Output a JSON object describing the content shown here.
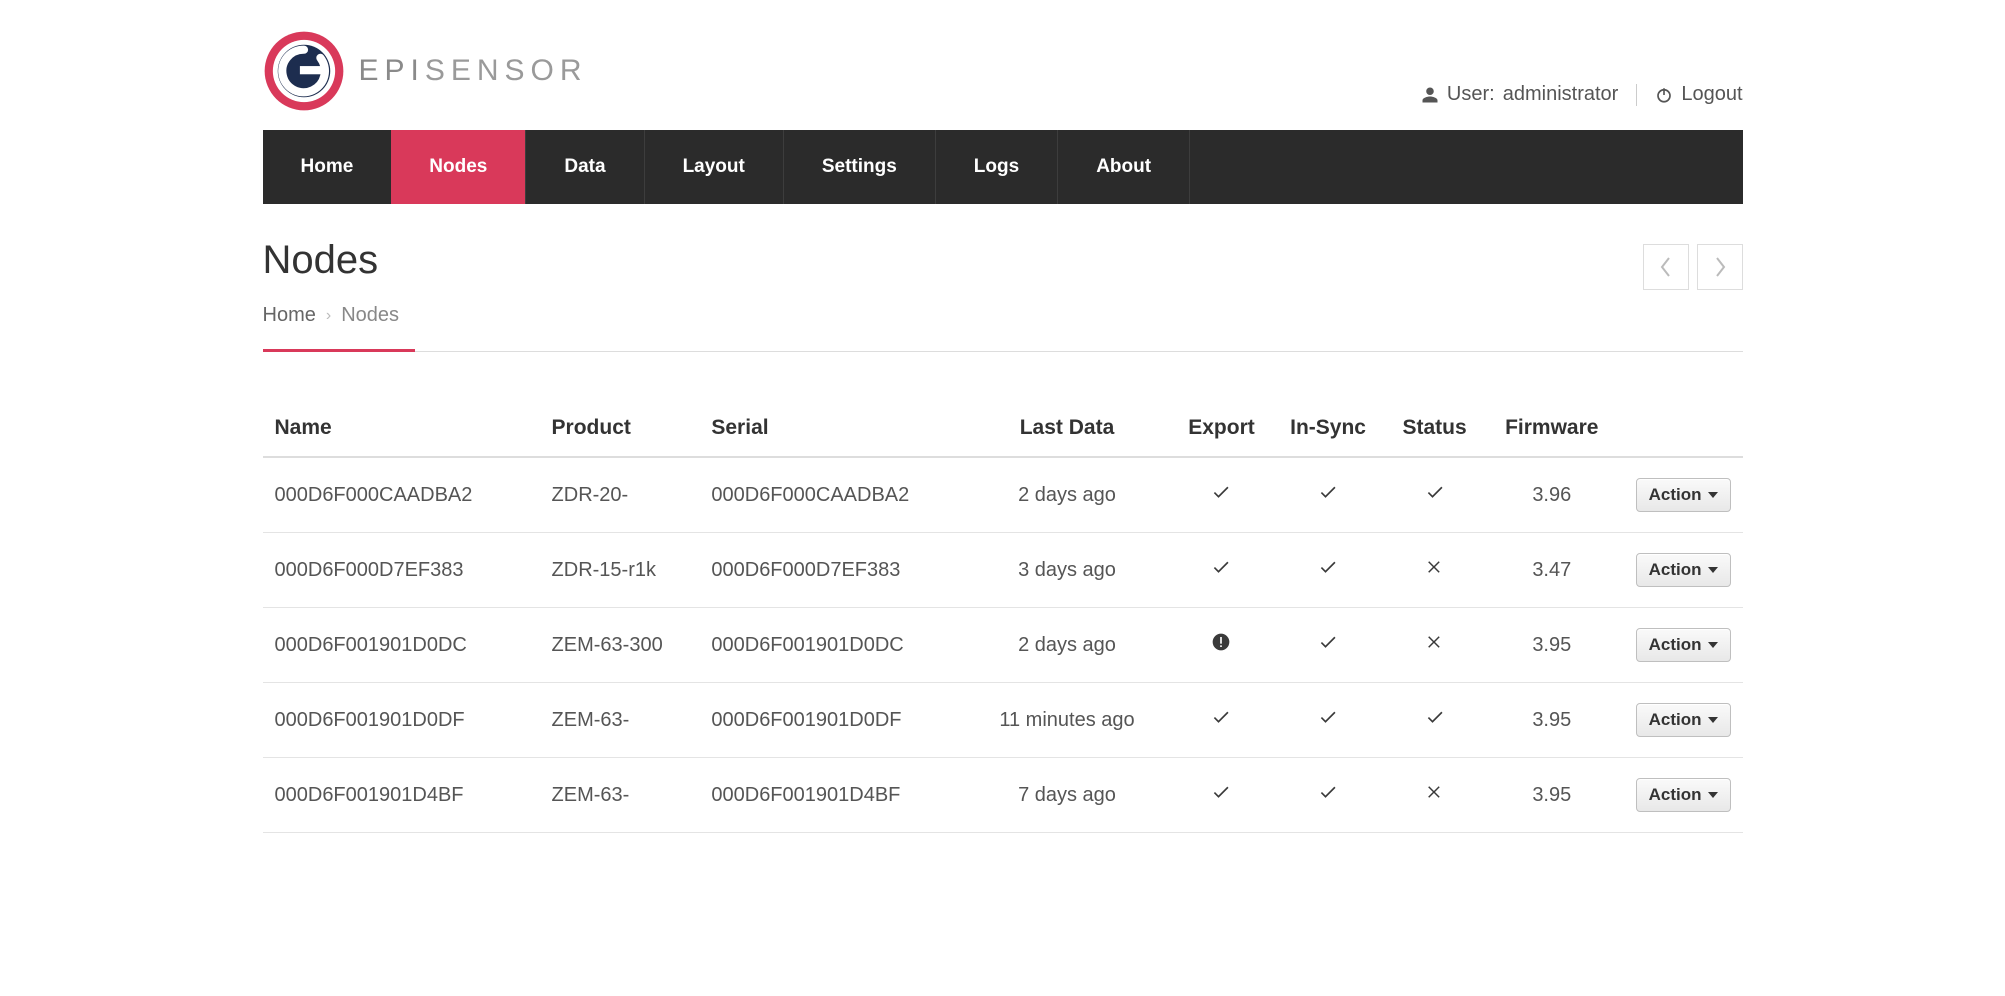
{
  "brand": {
    "name_prefix": "EPI",
    "name_suffix": "SENSOR"
  },
  "user_bar": {
    "user_label": "User:",
    "user_name": "administrator",
    "logout": "Logout"
  },
  "nav": {
    "items": [
      {
        "label": "Home"
      },
      {
        "label": "Nodes",
        "active": true
      },
      {
        "label": "Data"
      },
      {
        "label": "Layout"
      },
      {
        "label": "Settings"
      },
      {
        "label": "Logs"
      },
      {
        "label": "About"
      }
    ]
  },
  "page": {
    "title": "Nodes"
  },
  "breadcrumb": {
    "home": "Home",
    "current": "Nodes"
  },
  "table": {
    "headers": {
      "name": "Name",
      "product": "Product",
      "serial": "Serial",
      "last_data": "Last Data",
      "export": "Export",
      "in_sync": "In-Sync",
      "status": "Status",
      "firmware": "Firmware"
    },
    "action_label": "Action",
    "rows": [
      {
        "name": "000D6F000CAADBA2",
        "product": "ZDR-20-",
        "serial": "000D6F000CAADBA2",
        "last_data": "2 days ago",
        "export": "check",
        "in_sync": "check",
        "status": "check",
        "firmware": "3.96"
      },
      {
        "name": "000D6F000D7EF383",
        "product": "ZDR-15-r1k",
        "serial": "000D6F000D7EF383",
        "last_data": "3 days ago",
        "export": "check",
        "in_sync": "check",
        "status": "cross",
        "firmware": "3.47"
      },
      {
        "name": "000D6F001901D0DC",
        "product": "ZEM-63-300",
        "serial": "000D6F001901D0DC",
        "last_data": "2 days ago",
        "export": "warn",
        "in_sync": "check",
        "status": "cross",
        "firmware": "3.95"
      },
      {
        "name": "000D6F001901D0DF",
        "product": "ZEM-63-",
        "serial": "000D6F001901D0DF",
        "last_data": "11 minutes ago",
        "export": "check",
        "in_sync": "check",
        "status": "check",
        "firmware": "3.95"
      },
      {
        "name": "000D6F001901D4BF",
        "product": "ZEM-63-",
        "serial": "000D6F001901D4BF",
        "last_data": "7 days ago",
        "export": "check",
        "in_sync": "check",
        "status": "cross",
        "firmware": "3.95"
      }
    ]
  },
  "colors": {
    "accent": "#d9395a",
    "navbg": "#2b2b2b"
  }
}
